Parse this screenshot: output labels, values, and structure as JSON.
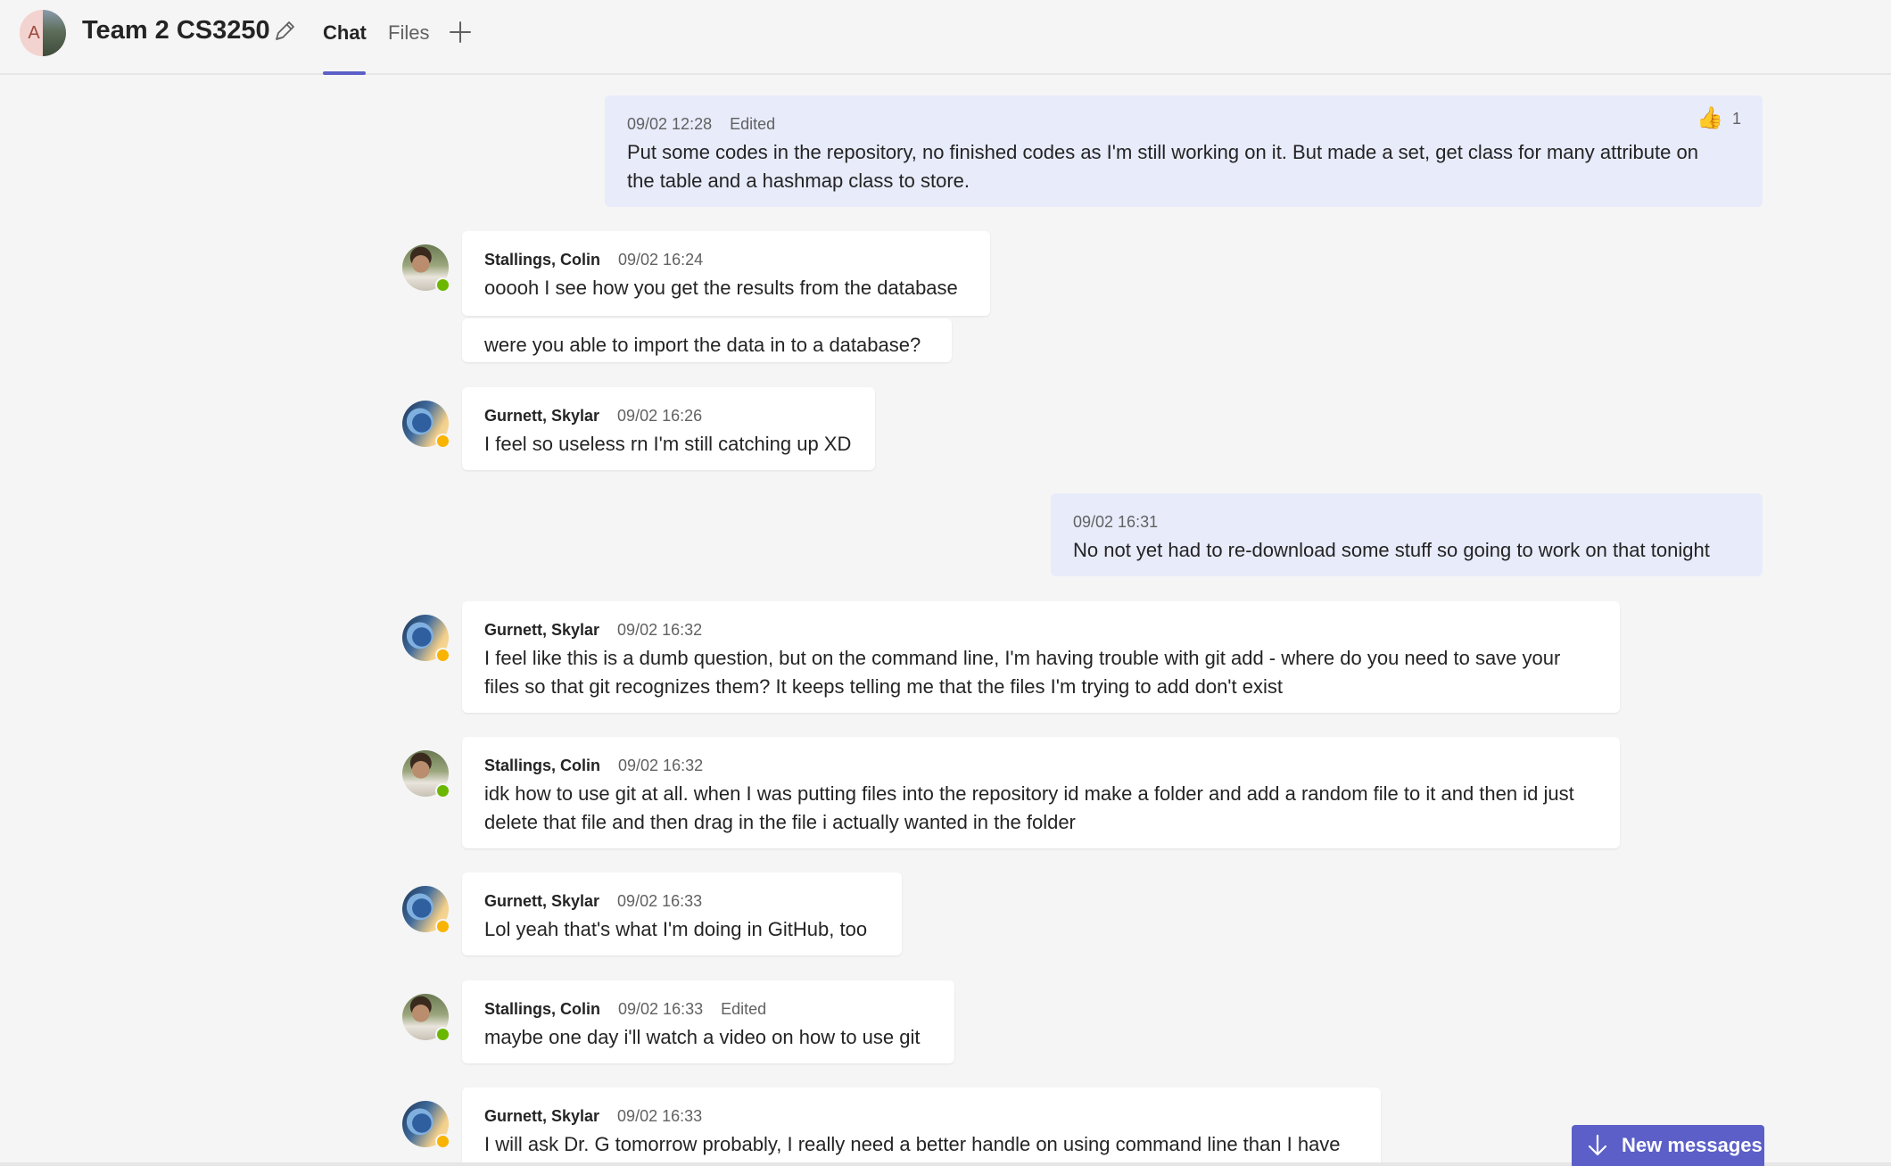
{
  "header": {
    "group_avatar_initial": "A",
    "title": "Team 2 CS3250",
    "tabs": [
      {
        "label": "Chat",
        "active": true
      },
      {
        "label": "Files",
        "active": false
      }
    ],
    "accent_color": "#5b5fc7"
  },
  "messages": [
    {
      "mine": true,
      "time": "09/02 12:28",
      "edited": "Edited",
      "text": "Put some codes in the repository, no finished codes as I'm still working on it. But made a set, get class for many attribute on the table and a hashmap class to store.",
      "reaction": {
        "icon": "thumbs-up-icon",
        "count": "1"
      }
    },
    {
      "mine": false,
      "author": "Stallings, Colin",
      "time": "09/02 16:24",
      "text": "ooooh I see how you get the results from the database",
      "presence": "available"
    },
    {
      "mine": false,
      "continuation": true,
      "text": "were you able to import the data in to a database?"
    },
    {
      "mine": false,
      "author": "Gurnett, Skylar",
      "time": "09/02 16:26",
      "text": "I feel so useless rn I'm still catching up XD",
      "presence": "away"
    },
    {
      "mine": true,
      "time": "09/02 16:31",
      "text": "No not yet had to re-download some stuff so going to work on that tonight"
    },
    {
      "mine": false,
      "author": "Gurnett, Skylar",
      "time": "09/02 16:32",
      "text": "I feel like this is a dumb question, but on the command line, I'm having trouble with git add - where do you need to save your files so that git recognizes them? It keeps telling me that the files I'm trying to add don't exist",
      "presence": "away"
    },
    {
      "mine": false,
      "author": "Stallings, Colin",
      "time": "09/02 16:32",
      "text": "idk how to use git at all. when I was putting files into the repository id make a folder and add a random file to it and then id just delete that file and then drag in the file i actually wanted in the folder",
      "presence": "available"
    },
    {
      "mine": false,
      "author": "Gurnett, Skylar",
      "time": "09/02 16:33",
      "text": "Lol yeah that's what I'm doing in GitHub, too",
      "presence": "away"
    },
    {
      "mine": false,
      "author": "Stallings, Colin",
      "time": "09/02 16:33",
      "edited": "Edited",
      "text": "maybe one day i'll watch a video on how to use git",
      "presence": "available"
    },
    {
      "mine": false,
      "author": "Gurnett, Skylar",
      "time": "09/02 16:33",
      "text": "I will ask Dr. G tomorrow probably, I really need a better handle on using command line than I have",
      "presence": "away"
    }
  ],
  "new_messages_button": {
    "label": "New messages",
    "icon": "arrow-down-icon"
  }
}
